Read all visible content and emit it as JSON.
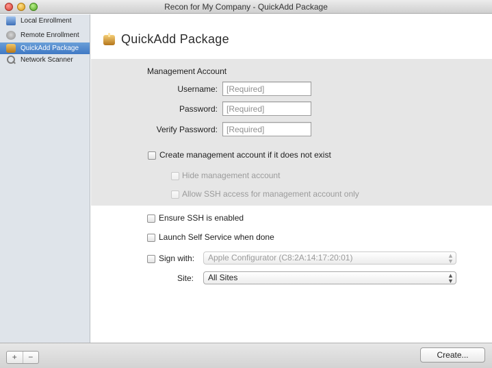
{
  "window": {
    "title": "Recon for My Company - QuickAdd Package"
  },
  "sidebar": {
    "items": [
      {
        "label": "Local Enrollment",
        "icon": "local-enrollment-icon"
      },
      {
        "label": "Remote Enrollment",
        "icon": "remote-enrollment-icon"
      },
      {
        "label": "QuickAdd Package",
        "icon": "package-icon",
        "selected": true
      },
      {
        "label": "Network Scanner",
        "icon": "magnifier-icon"
      }
    ]
  },
  "header": {
    "title": "QuickAdd Package"
  },
  "management_account": {
    "section_title": "Management Account",
    "username_label": "Username:",
    "username_placeholder": "[Required]",
    "password_label": "Password:",
    "password_placeholder": "[Required]",
    "verify_label": "Verify Password:",
    "verify_placeholder": "[Required]",
    "create_if_missing": "Create management account if it does not exist",
    "hide_account": "Hide management account",
    "allow_ssh": "Allow SSH access for management account only"
  },
  "options": {
    "ensure_ssh": "Ensure SSH is enabled",
    "launch_self_service": "Launch Self Service when done",
    "sign_with_label": "Sign with:",
    "sign_with_value": "Apple Configurator (C8:2A:14:17:20:01)",
    "site_label": "Site:",
    "site_value": "All Sites"
  },
  "footer": {
    "add": "+",
    "remove": "−",
    "create": "Create..."
  },
  "colors": {
    "selection": "#3f78c4",
    "group_bg": "#e6e6e6",
    "sidebar_bg": "#dfe4ea"
  }
}
